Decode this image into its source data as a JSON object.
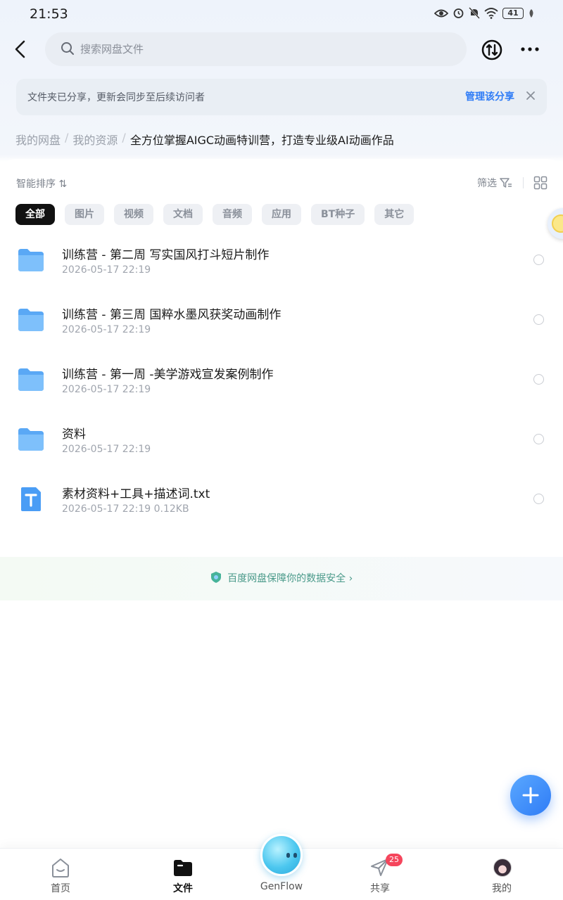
{
  "status_bar": {
    "time": "21:53",
    "battery": "41"
  },
  "search": {
    "placeholder": "搜索网盘文件"
  },
  "notice": {
    "message": "文件夹已分享，更新会同步至后续访问者",
    "action": "管理该分享"
  },
  "breadcrumb": {
    "items": [
      "我的网盘",
      "我的资源"
    ],
    "current": "全方位掌握AIGC动画特训营，打造专业级AI动画作品"
  },
  "toolbar": {
    "sort_label": "智能排序 ⇅",
    "filter_label": "筛选"
  },
  "filters": [
    "全部",
    "图片",
    "视频",
    "文档",
    "音频",
    "应用",
    "BT种子",
    "其它"
  ],
  "files": [
    {
      "name": "训练营 - 第二周  写实国风打斗短片制作",
      "meta": "2026-05-17  22:19",
      "type": "folder"
    },
    {
      "name": "训练营 - 第三周  国粹水墨风获奖动画制作",
      "meta": "2026-05-17  22:19",
      "type": "folder"
    },
    {
      "name": "训练营 - 第一周 -美学游戏宣发案例制作",
      "meta": "2026-05-17  22:19",
      "type": "folder"
    },
    {
      "name": "资料",
      "meta": "2026-05-17  22:19",
      "type": "folder"
    },
    {
      "name": "素材资料+工具+描述词.txt",
      "meta": "2026-05-17  22:19  0.12KB",
      "type": "txt"
    }
  ],
  "security_banner": "百度网盘保障你的数据安全",
  "tabs": [
    {
      "label": "首页",
      "icon": "home-icon"
    },
    {
      "label": "文件",
      "icon": "folder-icon"
    },
    {
      "label": "GenFlow",
      "icon": "genflow-orb"
    },
    {
      "label": "共享",
      "icon": "paper-plane-icon"
    },
    {
      "label": "我的",
      "icon": "avatar"
    }
  ],
  "share_badge": "25",
  "colors": {
    "accent": "#2f7cf6",
    "folder": "#5aa8f5",
    "badge": "#f5455c"
  }
}
